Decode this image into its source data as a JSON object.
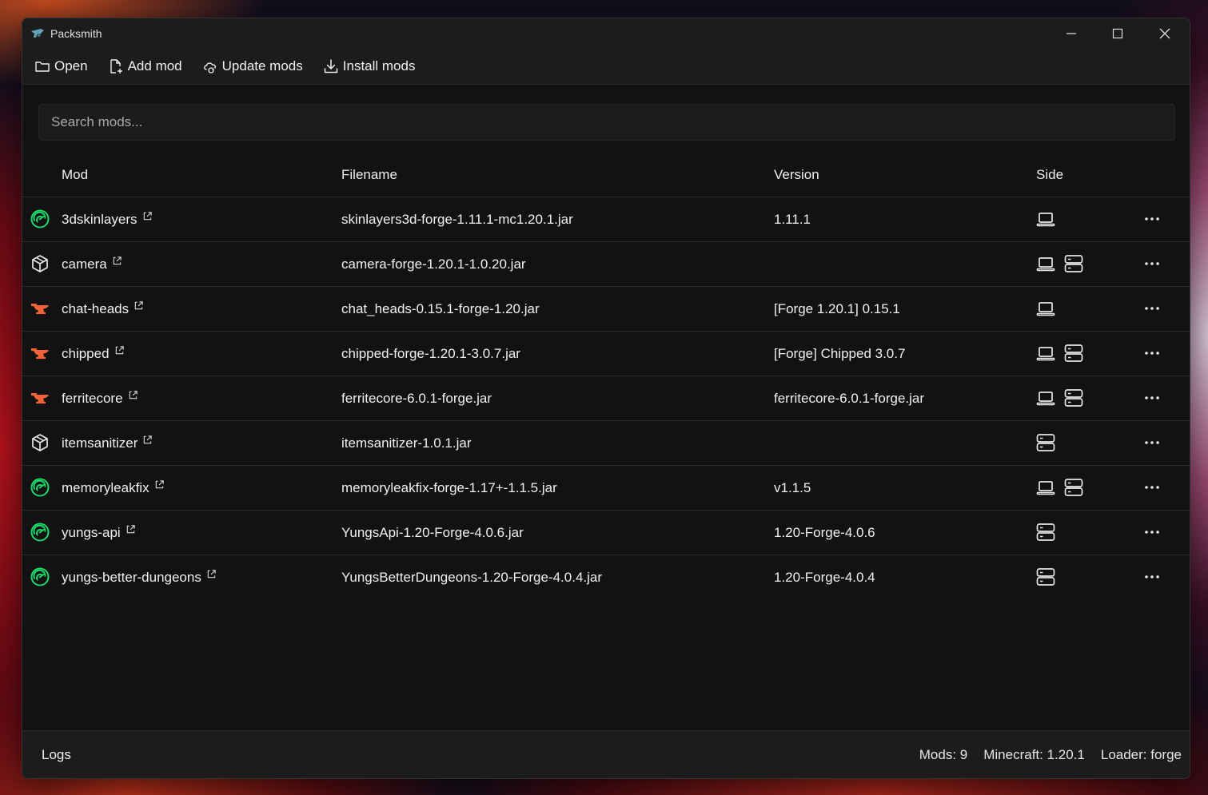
{
  "window": {
    "title": "Packsmith"
  },
  "toolbar": {
    "open_label": "Open",
    "add_mod_label": "Add mod",
    "update_mods_label": "Update mods",
    "install_mods_label": "Install mods"
  },
  "search": {
    "placeholder": "Search mods...",
    "value": ""
  },
  "table": {
    "headers": {
      "mod": "Mod",
      "filename": "Filename",
      "version": "Version",
      "side": "Side"
    },
    "rows": [
      {
        "mod": "3dskinlayers",
        "filename": "skinlayers3d-forge-1.11.1-mc1.20.1.jar",
        "version": "1.11.1",
        "source_icon": "modrinth-icon",
        "client": true,
        "server": false
      },
      {
        "mod": "camera",
        "filename": "camera-forge-1.20.1-1.0.20.jar",
        "version": "",
        "source_icon": "package-icon",
        "client": true,
        "server": true
      },
      {
        "mod": "chat-heads",
        "filename": "chat_heads-0.15.1-forge-1.20.jar",
        "version": "[Forge 1.20.1] 0.15.1",
        "source_icon": "curseforge-icon",
        "client": true,
        "server": false
      },
      {
        "mod": "chipped",
        "filename": "chipped-forge-1.20.1-3.0.7.jar",
        "version": "[Forge] Chipped 3.0.7",
        "source_icon": "curseforge-icon",
        "client": true,
        "server": true
      },
      {
        "mod": "ferritecore",
        "filename": "ferritecore-6.0.1-forge.jar",
        "version": "ferritecore-6.0.1-forge.jar",
        "source_icon": "curseforge-icon",
        "client": true,
        "server": true
      },
      {
        "mod": "itemsanitizer",
        "filename": "itemsanitizer-1.0.1.jar",
        "version": "",
        "source_icon": "package-icon",
        "client": false,
        "server": true
      },
      {
        "mod": "memoryleakfix",
        "filename": "memoryleakfix-forge-1.17+-1.1.5.jar",
        "version": "v1.1.5",
        "source_icon": "modrinth-icon",
        "client": true,
        "server": true
      },
      {
        "mod": "yungs-api",
        "filename": "YungsApi-1.20-Forge-4.0.6.jar",
        "version": "1.20-Forge-4.0.6",
        "source_icon": "modrinth-icon",
        "client": false,
        "server": true
      },
      {
        "mod": "yungs-better-dungeons",
        "filename": "YungsBetterDungeons-1.20-Forge-4.0.4.jar",
        "version": "1.20-Forge-4.0.4",
        "source_icon": "modrinth-icon",
        "client": false,
        "server": true
      }
    ]
  },
  "status": {
    "logs_label": "Logs",
    "mods_count": "Mods: 9",
    "minecraft_version": "Minecraft: 1.20.1",
    "loader": "Loader: forge"
  },
  "colors": {
    "modrinth": "#1bd96a",
    "curseforge": "#f16436",
    "background": "#121212",
    "panel": "#1c1c1c"
  }
}
